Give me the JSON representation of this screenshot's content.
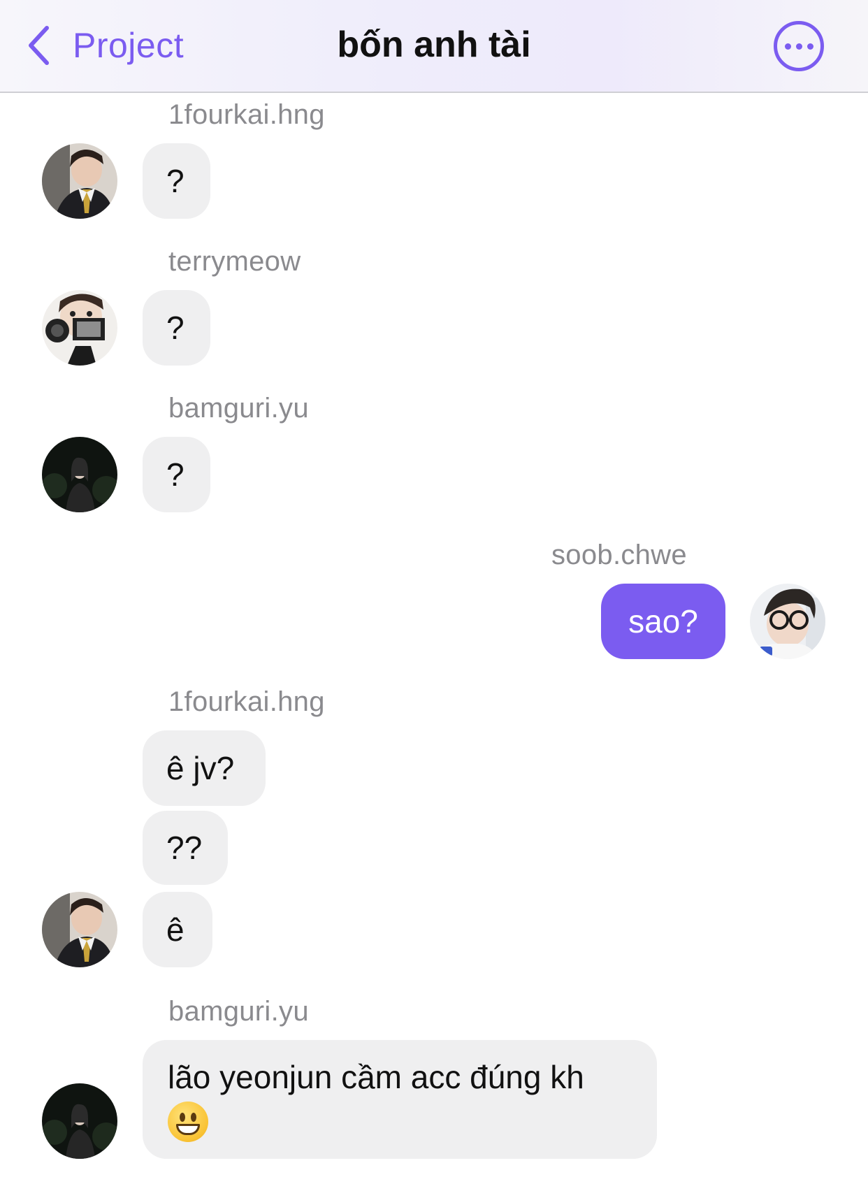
{
  "header": {
    "back_label": "Project",
    "title": "bốn anh tài",
    "accent": "#7b5cf0"
  },
  "messages": [
    {
      "sender": "1fourkai.hng",
      "text": "?"
    },
    {
      "sender": "terrymeow",
      "text": "?"
    },
    {
      "sender": "bamguri.yu",
      "text": "?"
    },
    {
      "sender": "soob.chwe",
      "text": "sao?",
      "outgoing": true
    },
    {
      "sender": "1fourkai.hng",
      "texts": [
        "ê jv?",
        "??",
        "ê"
      ]
    },
    {
      "sender": "bamguri.yu",
      "text": "lão yeonjun cầm acc đúng kh",
      "emoji": "grinning-face"
    }
  ],
  "colors": {
    "incoming_bubble": "#efeff0",
    "outgoing_bubble": "#7b5cf0",
    "sender_name": "#8a8a8e"
  }
}
